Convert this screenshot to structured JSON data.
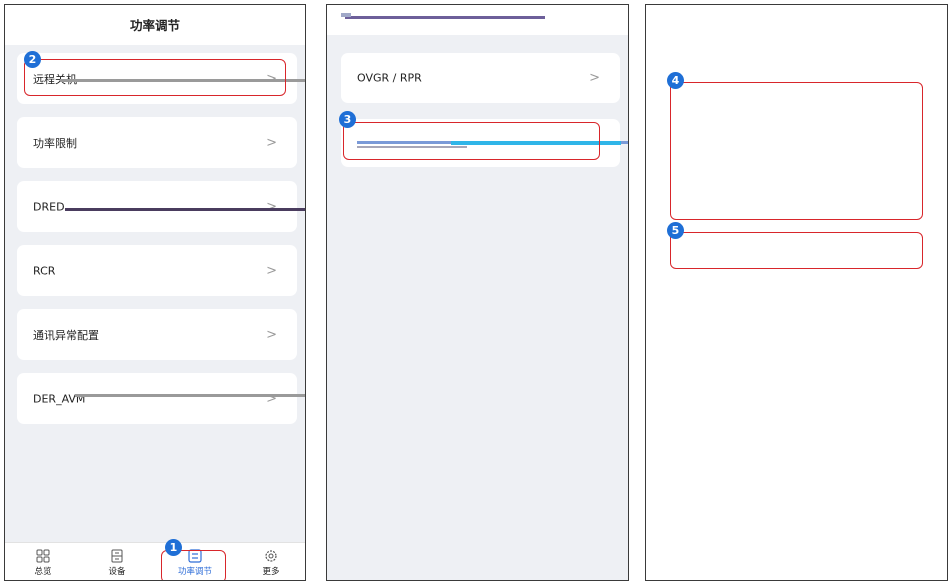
{
  "panel1": {
    "title": "功率调节",
    "items": [
      {
        "label": "远程关机",
        "badge": "2"
      },
      {
        "label": "功率限制"
      },
      {
        "label": "DRED"
      },
      {
        "label": "RCR"
      },
      {
        "label": "通讯异常配置"
      },
      {
        "label": "DER_AVM"
      }
    ],
    "chevron": ">",
    "nav": [
      {
        "label": "总览",
        "icon": "grid-icon"
      },
      {
        "label": "设备",
        "icon": "device-icon"
      },
      {
        "label": "功率调节",
        "icon": "power-adjust-icon",
        "active": true,
        "badge": "1"
      },
      {
        "label": "更多",
        "icon": "gear-icon"
      }
    ]
  },
  "panel2": {
    "items": [
      {
        "label": "OVGR / RPR"
      },
      {
        "label": "",
        "badge": "3"
      }
    ]
  },
  "panel3": {
    "badge4": "4",
    "badge5": "5"
  },
  "colors": {
    "accent": "#1f6fd6",
    "highlight": "#d8262b",
    "nav_active": "#2f6ed8"
  }
}
